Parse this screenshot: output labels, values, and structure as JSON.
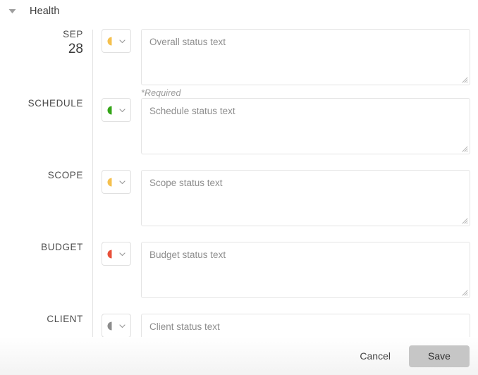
{
  "section": {
    "title": "Health",
    "caret_icon": "caret-down-icon",
    "expanded": true
  },
  "colors": {
    "amber": "#F5C04E",
    "green": "#34A518",
    "red": "#E8503A",
    "gray": "#8C8C8C",
    "border": "#E4E4E4",
    "divider": "#E3E3E3",
    "save_button_bg": "#C6C6C6",
    "placeholder_text": "#8D8D8D"
  },
  "rows": [
    {
      "label_type": "date",
      "date_month": "SEP",
      "date_day": "28",
      "status": {
        "icon": "half-circle-icon",
        "color_name": "amber",
        "color": "#F5C04E",
        "chevron_icon": "chevron-down-icon"
      },
      "textarea": {
        "placeholder": "Overall status text",
        "value": ""
      },
      "helper_text": "*Required"
    },
    {
      "label_type": "text",
      "label": "SCHEDULE",
      "status": {
        "icon": "half-circle-icon",
        "color_name": "green",
        "color": "#34A518",
        "chevron_icon": "chevron-down-icon"
      },
      "textarea": {
        "placeholder": "Schedule status text",
        "value": ""
      },
      "helper_text": ""
    },
    {
      "label_type": "text",
      "label": "SCOPE",
      "status": {
        "icon": "half-circle-icon",
        "color_name": "amber",
        "color": "#F5C04E",
        "chevron_icon": "chevron-down-icon"
      },
      "textarea": {
        "placeholder": "Scope status text",
        "value": ""
      },
      "helper_text": ""
    },
    {
      "label_type": "text",
      "label": "BUDGET",
      "status": {
        "icon": "half-circle-icon",
        "color_name": "red",
        "color": "#E8503A",
        "chevron_icon": "chevron-down-icon"
      },
      "textarea": {
        "placeholder": "Budget status text",
        "value": ""
      },
      "helper_text": ""
    },
    {
      "label_type": "text",
      "label": "CLIENT",
      "status": {
        "icon": "half-circle-icon",
        "color_name": "gray",
        "color": "#8C8C8C",
        "chevron_icon": "chevron-down-icon"
      },
      "textarea": {
        "placeholder": "Client status text",
        "value": ""
      },
      "helper_text": ""
    }
  ],
  "footer": {
    "cancel_label": "Cancel",
    "save_label": "Save"
  }
}
